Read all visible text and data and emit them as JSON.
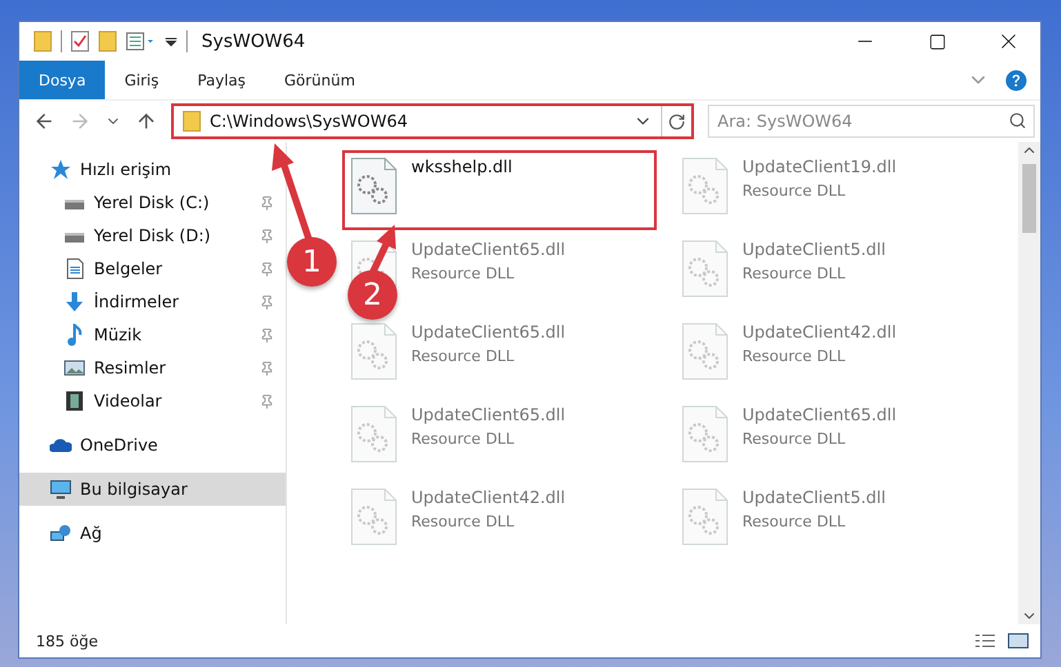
{
  "window": {
    "title": "SysWOW64"
  },
  "ribbon_tabs": [
    {
      "label": "Dosya",
      "selected": true
    },
    {
      "label": "Giriş",
      "selected": false
    },
    {
      "label": "Paylaş",
      "selected": false
    },
    {
      "label": "Görünüm",
      "selected": false
    }
  ],
  "address": {
    "path": "C:\\Windows\\SysWOW64",
    "highlighted": true
  },
  "search": {
    "placeholder": "Ara: SysWOW64"
  },
  "sidebar": {
    "items": [
      {
        "label": "Hızlı erişim",
        "kind": "star",
        "selected": false,
        "children": [
          {
            "label": "Yerel Disk (C:)",
            "kind": "drive",
            "pinned": true
          },
          {
            "label": "Yerel Disk (D:)",
            "kind": "drive",
            "pinned": true
          },
          {
            "label": "Belgeler",
            "kind": "document",
            "pinned": true
          },
          {
            "label": "İndirmeler",
            "kind": "download",
            "pinned": true
          },
          {
            "label": "Müzik",
            "kind": "music",
            "pinned": true
          },
          {
            "label": "Resimler",
            "kind": "picture",
            "pinned": true
          },
          {
            "label": "Videolar",
            "kind": "video",
            "pinned": true
          }
        ]
      },
      {
        "label": "OneDrive",
        "kind": "cloud",
        "selected": false
      },
      {
        "label": "Bu bilgisayar",
        "kind": "pc",
        "selected": true
      },
      {
        "label": "Ağ",
        "kind": "network",
        "selected": false
      }
    ]
  },
  "files": [
    {
      "name": "wksshelp.dll",
      "highlighted": true,
      "faded": false
    },
    {
      "name": "UpdateClient19.dll",
      "type": "Resource DLL",
      "highlighted": false,
      "faded": true
    },
    {
      "name": "UpdateClient65.dll",
      "type": "Resource DLL",
      "highlighted": false,
      "faded": true
    },
    {
      "name": "UpdateClient5.dll",
      "type": "Resource DLL",
      "highlighted": false,
      "faded": true
    },
    {
      "name": "UpdateClient65.dll",
      "type": "Resource DLL",
      "highlighted": false,
      "faded": true
    },
    {
      "name": "UpdateClient42.dll",
      "type": "Resource DLL",
      "highlighted": false,
      "faded": true
    },
    {
      "name": "UpdateClient65.dll",
      "type": "Resource DLL",
      "highlighted": false,
      "faded": true
    },
    {
      "name": "UpdateClient65.dll",
      "type": "Resource DLL",
      "highlighted": false,
      "faded": true
    },
    {
      "name": "UpdateClient42.dll",
      "type": "Resource DLL",
      "highlighted": false,
      "faded": true
    },
    {
      "name": "UpdateClient5.dll",
      "type": "Resource DLL",
      "highlighted": false,
      "faded": true
    }
  ],
  "annotations": [
    {
      "label": "1"
    },
    {
      "label": "2"
    }
  ],
  "status_bar": {
    "count": "185 öğe"
  }
}
